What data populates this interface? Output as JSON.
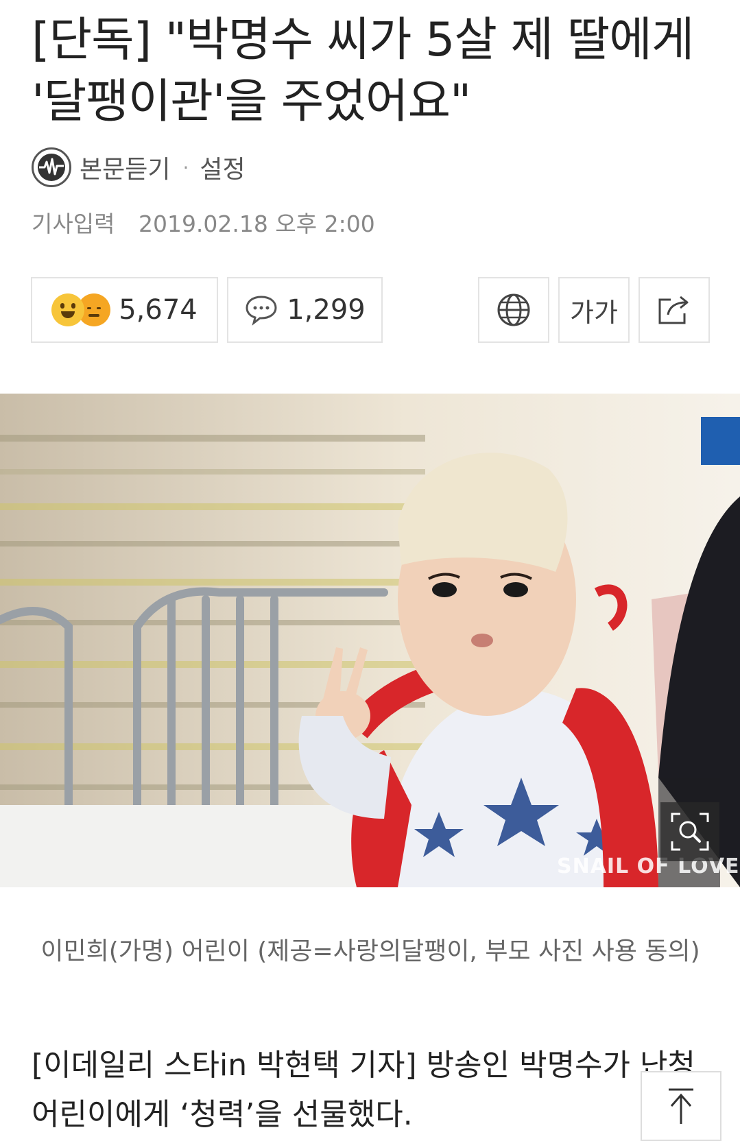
{
  "article": {
    "headline": "[단독] \"박명수 씨가 5살 제 딸에게 '달팽이관'을 주었어요\"",
    "tts_label": "본문듣기",
    "tts_separator": "·",
    "tts_settings": "설정",
    "published_label": "기사입력",
    "published_date": "2019.02.18 오후 2:00"
  },
  "actions": {
    "reaction_count": "5,674",
    "comment_count": "1,299",
    "font_size_label": "가가"
  },
  "photo": {
    "watermark": "SNAIL OF LOVE",
    "caption": "이민희(가명) 어린이 (제공=사랑의달팽이, 부모 사진 사용 동의)"
  },
  "body": {
    "paragraph_1": "[이데일리 스타in 박현택 기자] 방송인 박명수가 난청 어린이에게 ‘청력’을 선물했다."
  },
  "icons": {
    "tts": "headphone-wave-icon",
    "comment": "speech-bubble-icon",
    "translate": "globe-icon",
    "share": "share-arrow-icon",
    "zoom": "zoom-magnifier-icon",
    "top": "arrow-up-icon"
  },
  "colors": {
    "backpack": "#d8262a",
    "reaction_yellow": "#f7c53a"
  }
}
